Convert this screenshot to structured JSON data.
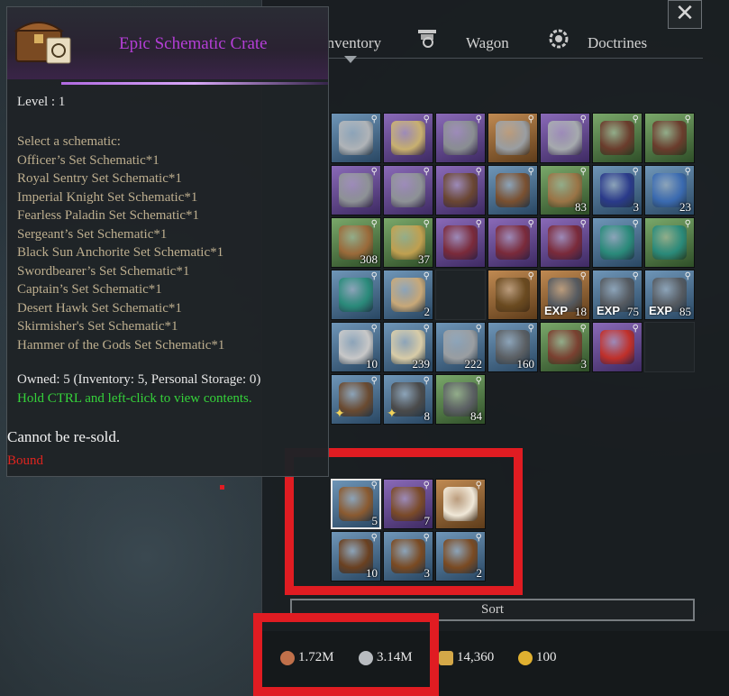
{
  "window": {
    "close_label": "✕"
  },
  "tabs": [
    {
      "label": "Inventory",
      "icon": "backpack-icon"
    },
    {
      "label": "Wagon",
      "icon": "wagon-icon"
    },
    {
      "label": "Doctrines",
      "icon": "doctrine-gear-icon"
    }
  ],
  "tooltip": {
    "title": "Epic Schematic Crate",
    "level": "Level : 1",
    "select_label": "Select a schematic:",
    "schematics": [
      "Officer’s Set Schematic*1",
      "Royal Sentry Set Schematic*1",
      "Imperial Knight Set Schematic*1",
      "Fearless Paladin Set Schematic*1",
      "Sergeant’s Set Schematic*1",
      "Black Sun Anchorite Set Schematic*1",
      "Swordbearer’s Set Schematic*1",
      "Captain’s Set Schematic*1",
      "Desert Hawk Set Schematic*1",
      "Skirmisher's Set Schematic*1",
      "Hammer of the Gods Set Schematic*1"
    ],
    "owned": "Owned: 5 (Inventory: 5, Personal Storage: 0)",
    "hint": "Hold CTRL and left-click to view contents.",
    "resale": "Cannot be re-sold.",
    "bound": "Bound"
  },
  "inventory": {
    "items": [
      {
        "name": "war-hammer",
        "rarity": "blue",
        "count": "",
        "color": "#b0b4b8"
      },
      {
        "name": "halberd",
        "rarity": "purple",
        "count": "",
        "color": "#c8b070"
      },
      {
        "name": "kite-shield",
        "rarity": "purple",
        "count": "",
        "color": "#8a8e92"
      },
      {
        "name": "steel-helmet",
        "rarity": "orange",
        "count": "",
        "color": "#9a9ea2"
      },
      {
        "name": "steel-helmet",
        "rarity": "purple",
        "count": "",
        "color": "#a6aaae"
      },
      {
        "name": "leather-helmet",
        "rarity": "green",
        "count": "",
        "color": "#6a3c2c"
      },
      {
        "name": "leather-helmet",
        "rarity": "green",
        "count": "",
        "color": "#6a3c2c"
      },
      {
        "name": "gauntlets",
        "rarity": "purple",
        "count": "",
        "color": "#8e9296"
      },
      {
        "name": "gauntlets",
        "rarity": "purple",
        "count": "",
        "color": "#8e9296"
      },
      {
        "name": "boots",
        "rarity": "purple",
        "count": "",
        "color": "#6a4632"
      },
      {
        "name": "saddle",
        "rarity": "blue",
        "count": "",
        "color": "#7a5030"
      },
      {
        "name": "fur-pelt",
        "rarity": "green",
        "count": "83",
        "color": "#9a7446"
      },
      {
        "name": "spiked-banner",
        "rarity": "blue",
        "count": "3",
        "color": "#2a3a8a"
      },
      {
        "name": "warrior-token",
        "rarity": "blue",
        "count": "23",
        "color": "#3a6ab0"
      },
      {
        "name": "leather-armor",
        "rarity": "green",
        "count": "308",
        "color": "#9a6a3a"
      },
      {
        "name": "war-horn",
        "rarity": "green",
        "count": "37",
        "color": "#c0a050"
      },
      {
        "name": "tome-iii",
        "rarity": "purple",
        "count": "",
        "color": "#7a2a3a"
      },
      {
        "name": "tome-ii",
        "rarity": "purple",
        "count": "",
        "color": "#7a2a3a"
      },
      {
        "name": "tome-i",
        "rarity": "purple",
        "count": "",
        "color": "#7a2a3a"
      },
      {
        "name": "tome-iv",
        "rarity": "blue",
        "count": "",
        "color": "#2a8a7a"
      },
      {
        "name": "tome-iii-teal",
        "rarity": "green",
        "count": "",
        "color": "#2a8a7a"
      },
      {
        "name": "tome-i-teal",
        "rarity": "blue",
        "count": "",
        "color": "#2a8a7a"
      },
      {
        "name": "open-book",
        "rarity": "blue",
        "count": "2",
        "color": "#c8a878"
      },
      {
        "name": "",
        "rarity": "empty",
        "count": "",
        "color": ""
      },
      {
        "name": "golden-book",
        "rarity": "orange",
        "count": "",
        "color": "#6a4a20"
      },
      {
        "name": "exp-soldier",
        "rarity": "orange",
        "count": "18",
        "color": "#555a60",
        "exp": "EXP"
      },
      {
        "name": "exp-soldier",
        "rarity": "blue",
        "count": "75",
        "color": "#555a60",
        "exp": "EXP"
      },
      {
        "name": "exp-knight",
        "rarity": "blue",
        "count": "85",
        "color": "#555a60",
        "exp": "EXP"
      },
      {
        "name": "silver-ore",
        "rarity": "blue",
        "count": "10",
        "color": "#c8c8c8"
      },
      {
        "name": "rope",
        "rarity": "blue",
        "count": "239",
        "color": "#d8cca8"
      },
      {
        "name": "iron-plate",
        "rarity": "blue",
        "count": "222",
        "color": "#9a9ea2"
      },
      {
        "name": "steel-ingot",
        "rarity": "blue",
        "count": "160",
        "color": "#5a5e62"
      },
      {
        "name": "leather-strap",
        "rarity": "green",
        "count": "3",
        "color": "#7a4030"
      },
      {
        "name": "firework-rocket",
        "rarity": "purple",
        "count": "",
        "color": "#c0302a"
      },
      {
        "name": "",
        "rarity": "empty",
        "count": "",
        "color": ""
      },
      {
        "name": "cannon-cart",
        "rarity": "blue",
        "count": "",
        "color": "#6a4a30",
        "puzzle": true
      },
      {
        "name": "cannon",
        "rarity": "blue",
        "count": "8",
        "color": "#4a4a4a",
        "puzzle": true
      },
      {
        "name": "dumbbells",
        "rarity": "green",
        "count": "84",
        "color": "#5a5e62"
      }
    ]
  },
  "crates": {
    "items": [
      {
        "name": "epic-schematic-crate",
        "rarity": "blue",
        "count": "5",
        "color": "#8a5a30",
        "selected": true
      },
      {
        "name": "schematic-crate",
        "rarity": "purple",
        "count": "7",
        "color": "#7a4a28"
      },
      {
        "name": "unlock-scroll",
        "rarity": "orange",
        "count": "",
        "color": "#f0e8d8"
      },
      {
        "name": "crate-tools",
        "rarity": "blue",
        "count": "10",
        "color": "#6a4020"
      },
      {
        "name": "treasure-crate",
        "rarity": "blue",
        "count": "3",
        "color": "#7a4a22"
      },
      {
        "name": "treasure-crate",
        "rarity": "blue",
        "count": "2",
        "color": "#7a4a22"
      }
    ]
  },
  "sort_label": "Sort",
  "currencies": [
    {
      "name": "copper",
      "value": "1.72M",
      "color": "#c0704a"
    },
    {
      "name": "silver",
      "value": "3.14M",
      "color": "#b8bcc0"
    },
    {
      "name": "honor",
      "value": "14,360",
      "color": "#d4a848"
    },
    {
      "name": "gold",
      "value": "100",
      "color": "#e0b030"
    }
  ]
}
